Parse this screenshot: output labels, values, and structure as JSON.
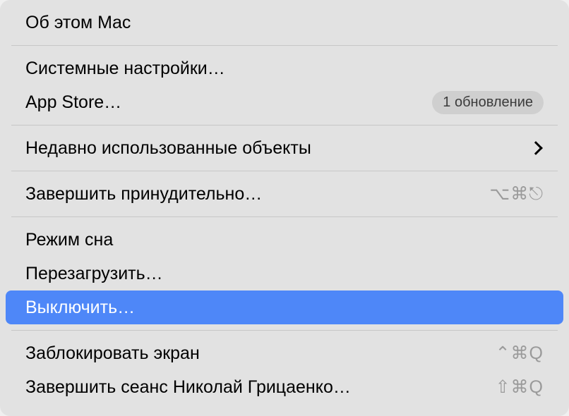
{
  "menu": {
    "about": "Об этом Mac",
    "systemSettings": "Системные настройки…",
    "appStore": "App Store…",
    "appStoreBadge": "1 обновление",
    "recentItems": "Недавно использованные объекты",
    "forceQuit": "Завершить принудительно…",
    "forceQuitShortcut": "⌥⌘⎋",
    "sleep": "Режим сна",
    "restart": "Перезагрузить…",
    "shutdown": "Выключить…",
    "lockScreen": "Заблокировать экран",
    "lockScreenShortcut": "⌃⌘Q",
    "logOut": "Завершить сеанс Николай Грицаенко…",
    "logOutShortcut": "⇧⌘Q"
  }
}
